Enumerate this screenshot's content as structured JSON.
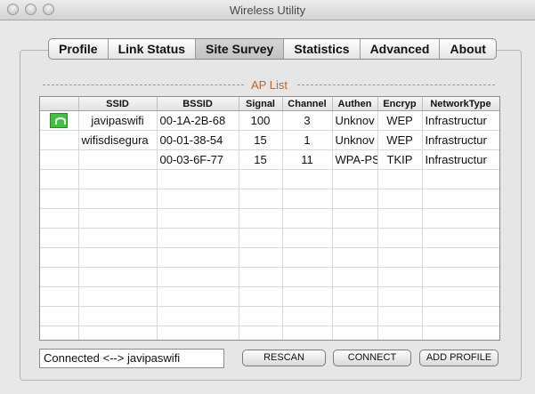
{
  "window": {
    "title": "Wireless Utility"
  },
  "tabs": [
    {
      "label": "Profile"
    },
    {
      "label": "Link Status"
    },
    {
      "label": "Site Survey",
      "active": true
    },
    {
      "label": "Statistics"
    },
    {
      "label": "Advanced"
    },
    {
      "label": "About"
    }
  ],
  "ap_list": {
    "title": "AP List",
    "columns": [
      "",
      "SSID",
      "BSSID",
      "Signal",
      "Channel",
      "Authen",
      "Encryp",
      "NetworkType"
    ],
    "rows": [
      {
        "connected": true,
        "ssid": "javipaswifi",
        "bssid": "00-1A-2B-68",
        "signal": "100",
        "channel": "3",
        "authen": "Unknov",
        "encryp": "WEP",
        "networktype": "Infrastructur"
      },
      {
        "connected": false,
        "ssid": "wifisdisegura",
        "bssid": "00-01-38-54",
        "signal": "15",
        "channel": "1",
        "authen": "Unknov",
        "encryp": "WEP",
        "networktype": "Infrastructur"
      },
      {
        "connected": false,
        "ssid": "",
        "bssid": "00-03-6F-77",
        "signal": "15",
        "channel": "11",
        "authen": "WPA-PS",
        "encryp": "TKIP",
        "networktype": "Infrastructur"
      }
    ],
    "empty_rows": 10
  },
  "status": {
    "text": "Connected <--> javipaswifi"
  },
  "buttons": {
    "rescan": "RESCAN",
    "connect": "CONNECT",
    "add_profile": "ADD PROFILE"
  },
  "icons": {
    "connected_row": "wifi-connected-icon"
  }
}
